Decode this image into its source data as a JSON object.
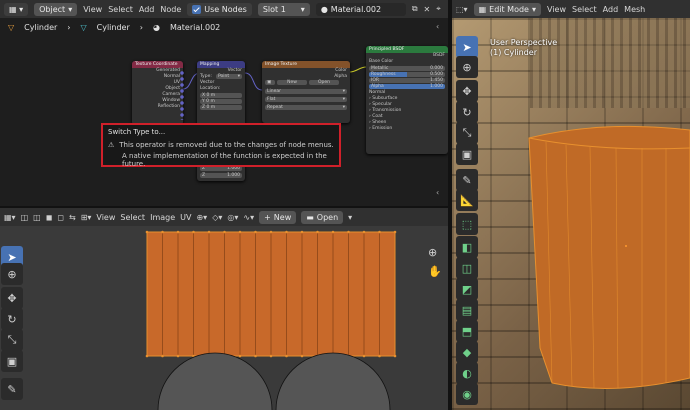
{
  "node_header": {
    "editor_type": "Object",
    "menus": [
      "View",
      "Select",
      "Add",
      "Node"
    ],
    "use_nodes_label": "Use Nodes",
    "slot": "Slot 1",
    "material": "Material.002"
  },
  "breadcrumb": {
    "object": "Cylinder",
    "mesh": "Cylinder",
    "material": "Material.002"
  },
  "nodes": {
    "texcoord": {
      "title": "Texture Coordinate",
      "outputs": [
        "Generated",
        "Normal",
        "UV",
        "Object",
        "Camera",
        "Window",
        "Reflection"
      ]
    },
    "mapping": {
      "title": "Mapping",
      "out": "Vector",
      "type_label": "Type:",
      "type_value": "Point",
      "vector_label": "Vector",
      "location_label": "Location:",
      "fields": [
        "X  0 m",
        "Y  0 m",
        "Z  0 m"
      ],
      "scale": [
        {
          "axis": "Z",
          "value": "1.000"
        },
        {
          "axis": "Z",
          "value": "1.000"
        }
      ]
    },
    "image": {
      "title": "Image Texture",
      "color": "Color",
      "alpha": "Alpha",
      "new": "New",
      "open": "Open",
      "interp": "Linear",
      "proj": "Flat",
      "ext": "Repeat"
    },
    "bsdf": {
      "title": "Principled BSDF",
      "bsdf_out": "BSDF",
      "base_color": "Base Color",
      "metallic": "Metallic",
      "metallic_val": "0.000",
      "roughness": "Roughness",
      "roughness_val": "0.500",
      "ior": "IOR",
      "ior_val": "1.450",
      "alpha": "Alpha",
      "alpha_val": "1.000",
      "normal": "Normal",
      "sections": [
        "Subsurface",
        "Specular",
        "Transmission",
        "Coat",
        "Sheen",
        "Emission"
      ]
    }
  },
  "tooltip": {
    "title": "Switch Type to...",
    "line1": "This operator is removed due to the changes of node menus.",
    "line2": "A native implementation of the function is expected in the future."
  },
  "uv_header": {
    "menus": [
      "View",
      "Select",
      "Image",
      "UV"
    ],
    "new": "New",
    "open": "Open"
  },
  "view3d_header": {
    "mode": "Edit Mode",
    "menus": [
      "View",
      "Select",
      "Add",
      "Mesh"
    ]
  },
  "viewport": {
    "perspective": "User Perspective",
    "object": "(1) Cylinder"
  },
  "colors": {
    "accent": "#4772b3",
    "uv_fill": "#c8692a",
    "orange": "#e8902e",
    "tooltip_border": "#d0202a"
  }
}
